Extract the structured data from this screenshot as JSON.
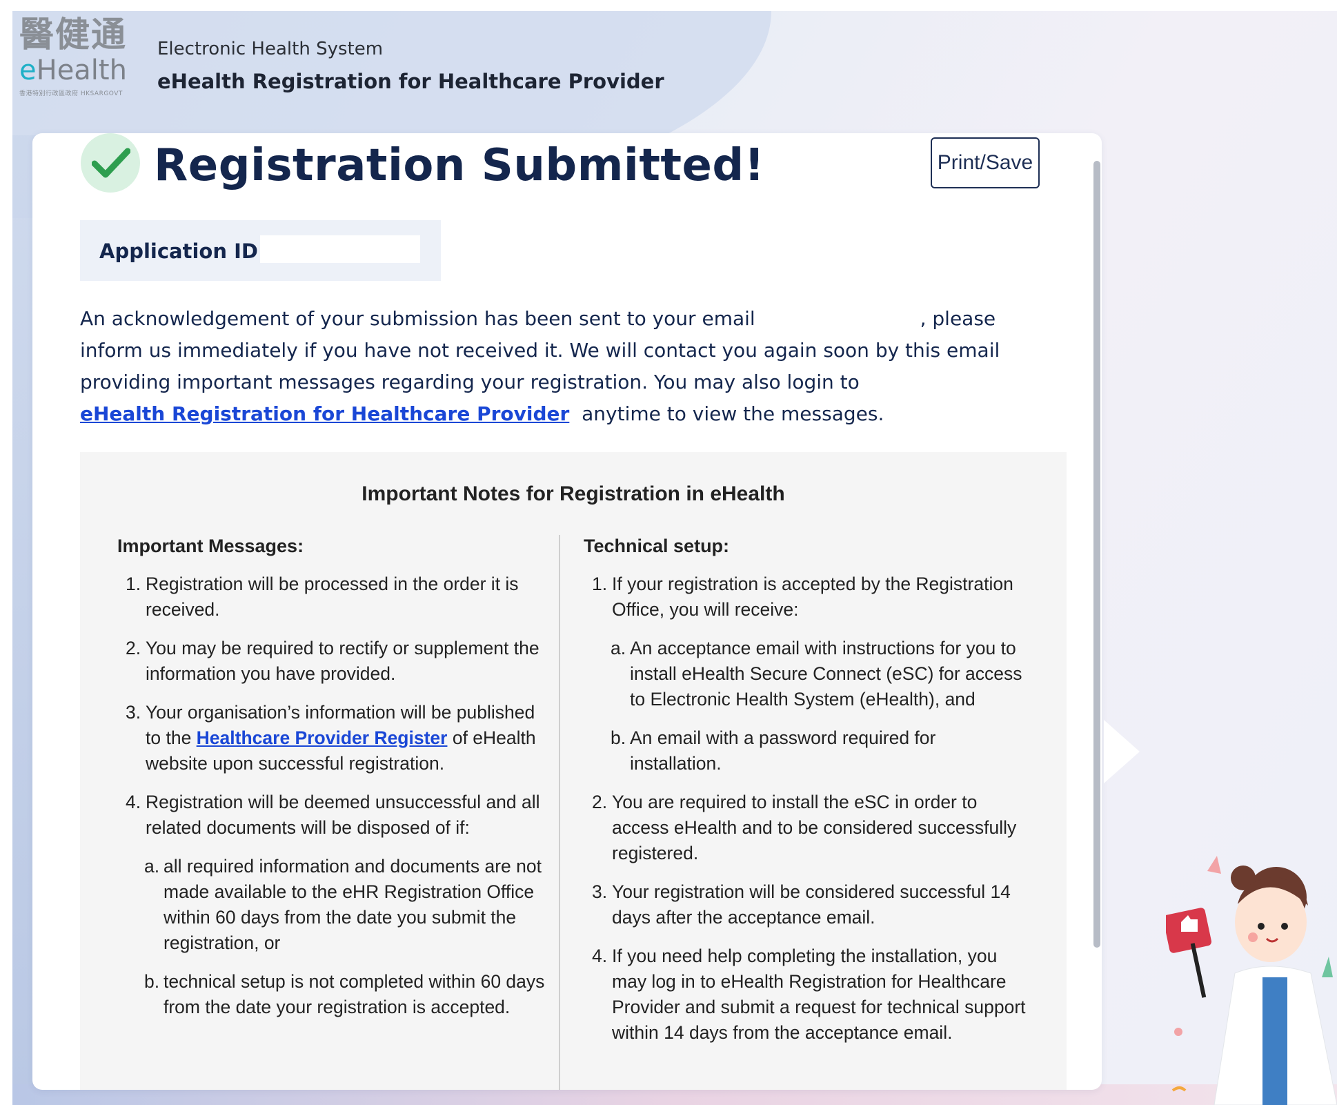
{
  "header": {
    "logo_cn": "醫健通",
    "logo_en": "eHealth",
    "logo_tiny": "香港特別行政區政府 HKSARGOVT",
    "system_name": "Electronic Health System",
    "app_title": "eHealth Registration for Healthcare Provider"
  },
  "card": {
    "title": "Registration Submitted!",
    "print_label": "Print/Save",
    "app_id_label": "Application ID :",
    "app_id_value": "",
    "ack_part1": "An acknowledgement of your submission has been sent to your email",
    "ack_email": "",
    "ack_part2": ", please inform us immediately if you have not received it. We will contact you again soon by this email providing important messages regarding your registration. You may also login to",
    "ack_link": "eHealth Registration for Healthcare Provider",
    "ack_part3": "anytime to view the messages."
  },
  "notes": {
    "title": "Important Notes for Registration in eHealth",
    "left": {
      "heading": "Important Messages:",
      "items": [
        {
          "n": "1.",
          "text": "Registration will be processed in the order it is received."
        },
        {
          "n": "2.",
          "text": "You may be required to rectify or supplement the information you have provided."
        },
        {
          "n": "3.",
          "pre": "Your organisation’s information will be published to the ",
          "link": "Healthcare Provider Register",
          "post": " of eHealth website upon successful registration."
        },
        {
          "n": "4.",
          "text": "Registration will be deemed unsuccessful and all related documents will be disposed of if:"
        }
      ],
      "subitems": [
        {
          "n": "a.",
          "text": "all required information and documents are not made available to the eHR Registration Office within 60 days from the date you submit the registration, or"
        },
        {
          "n": "b.",
          "text": "technical setup is not completed within 60 days from the date your registration is accepted."
        }
      ]
    },
    "right": {
      "heading": "Technical setup:",
      "item1": {
        "n": "1.",
        "text": "If your registration is accepted by the Registration Office, you will receive:"
      },
      "subitems": [
        {
          "n": "a.",
          "text": "An acceptance email with instructions for you to install eHealth Secure Connect (eSC) for access to Electronic Health System (eHealth), and"
        },
        {
          "n": "b.",
          "text": "An email with a password required for installation."
        }
      ],
      "items": [
        {
          "n": "2.",
          "text": "You are required to install the eSC in order to access eHealth and to be considered successfully registered."
        },
        {
          "n": "3.",
          "text": "Your registration will be considered successful 14 days after the acceptance email."
        },
        {
          "n": "4.",
          "text": "If you need help completing the installation, you may log in to eHealth Registration for Healthcare Provider and submit a request for technical support within 14 days from the acceptance email."
        }
      ]
    }
  },
  "colors": {
    "navy": "#14264d",
    "link": "#1a47d6",
    "check_green": "#2e9e4f",
    "check_bg": "#d9f1e1",
    "notes_bg": "#f5f5f5"
  }
}
